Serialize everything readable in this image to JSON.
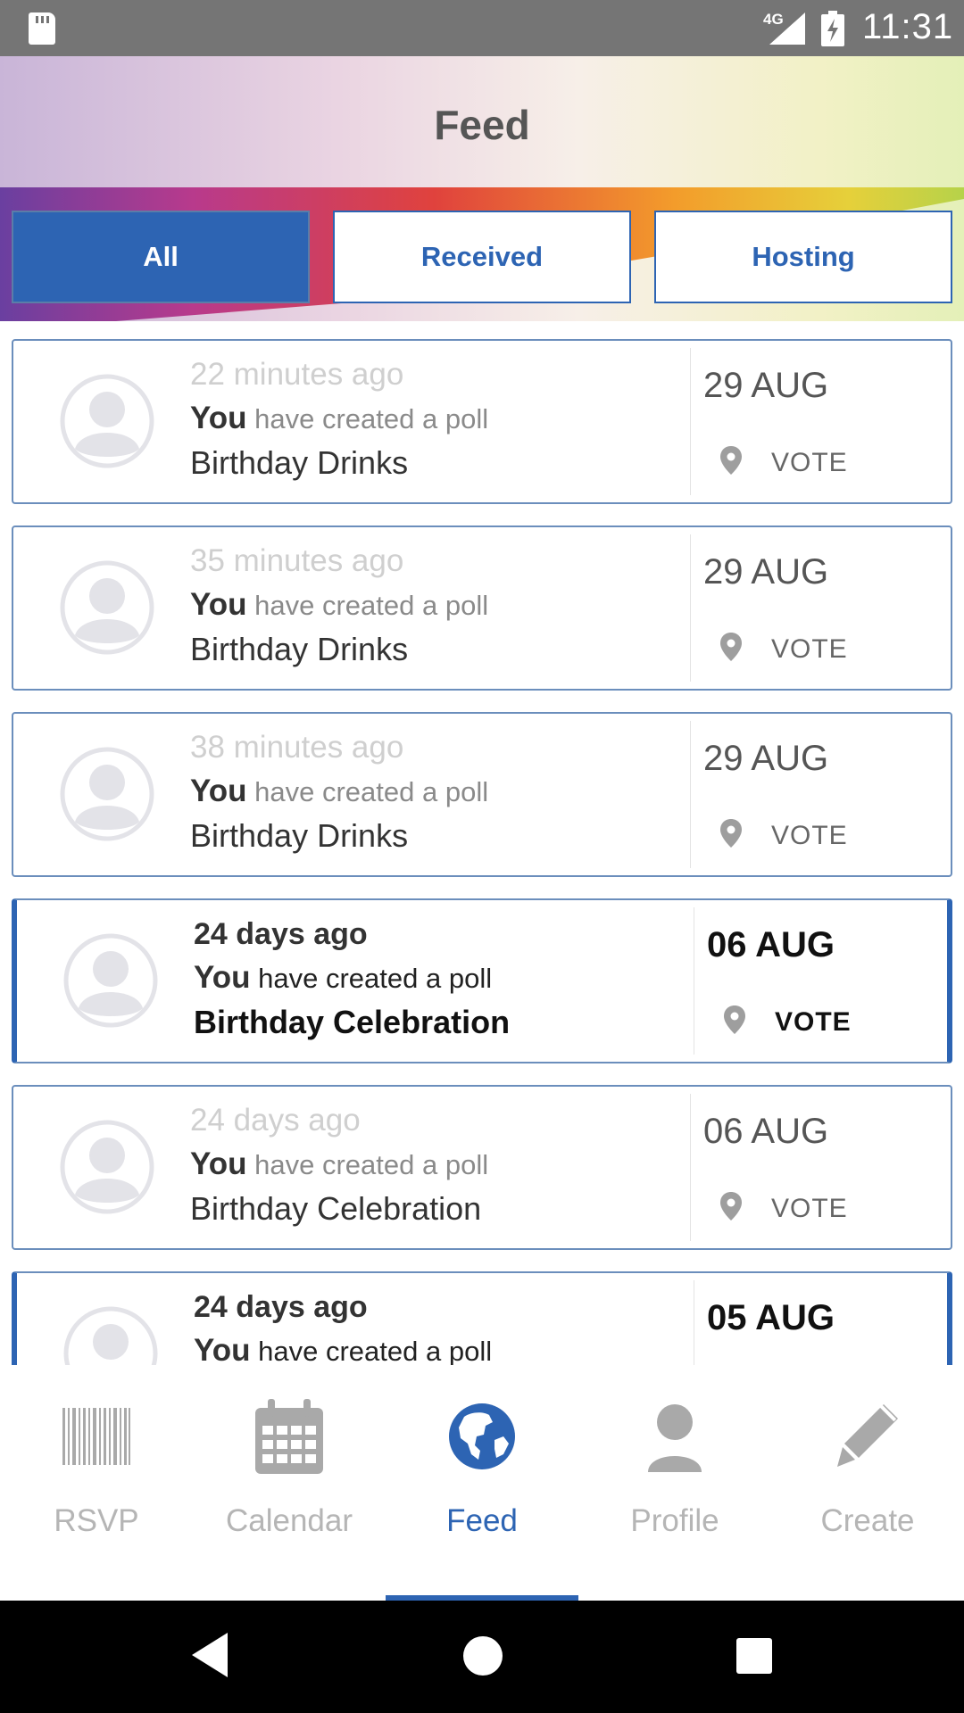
{
  "status_bar": {
    "network": "4G",
    "time": "11:31",
    "icons": [
      "sd-card-icon",
      "signal-icon",
      "battery-charging-icon"
    ]
  },
  "header": {
    "title": "Feed"
  },
  "tabs": [
    {
      "label": "All",
      "active": true
    },
    {
      "label": "Received",
      "active": false
    },
    {
      "label": "Hosting",
      "active": false
    }
  ],
  "feed": {
    "items": [
      {
        "time": "22 minutes ago",
        "actor": "You",
        "action": "have created a poll",
        "event": "Birthday Drinks",
        "date": "29 AUG",
        "status": "VOTE",
        "unread": false
      },
      {
        "time": "35 minutes ago",
        "actor": "You",
        "action": "have created a poll",
        "event": "Birthday Drinks",
        "date": "29 AUG",
        "status": "VOTE",
        "unread": false
      },
      {
        "time": "38 minutes ago",
        "actor": "You",
        "action": "have created a poll",
        "event": "Birthday Drinks",
        "date": "29 AUG",
        "status": "VOTE",
        "unread": false
      },
      {
        "time": "24 days ago",
        "actor": "You",
        "action": "have created a poll",
        "event": "Birthday Celebration",
        "date": "06 AUG",
        "status": "VOTE",
        "unread": true
      },
      {
        "time": "24 days ago",
        "actor": "You",
        "action": "have created a poll",
        "event": "Birthday Celebration",
        "date": "06 AUG",
        "status": "VOTE",
        "unread": false
      },
      {
        "time": "24 days ago",
        "actor": "You",
        "action": "have created a poll",
        "event": "",
        "date": "05 AUG",
        "status": "",
        "unread": true
      }
    ]
  },
  "bottom_nav": {
    "items": [
      {
        "label": "RSVP",
        "icon": "barcode-icon",
        "active": false
      },
      {
        "label": "Calendar",
        "icon": "calendar-icon",
        "active": false
      },
      {
        "label": "Feed",
        "icon": "globe-icon",
        "active": true
      },
      {
        "label": "Profile",
        "icon": "person-icon",
        "active": false
      },
      {
        "label": "Create",
        "icon": "pencil-icon",
        "active": false
      }
    ]
  },
  "colors": {
    "accent": "#2d64b3",
    "status_bar": "#757575",
    "inactive_nav": "#b5b5b5",
    "card_border": "#6b8ebc"
  }
}
